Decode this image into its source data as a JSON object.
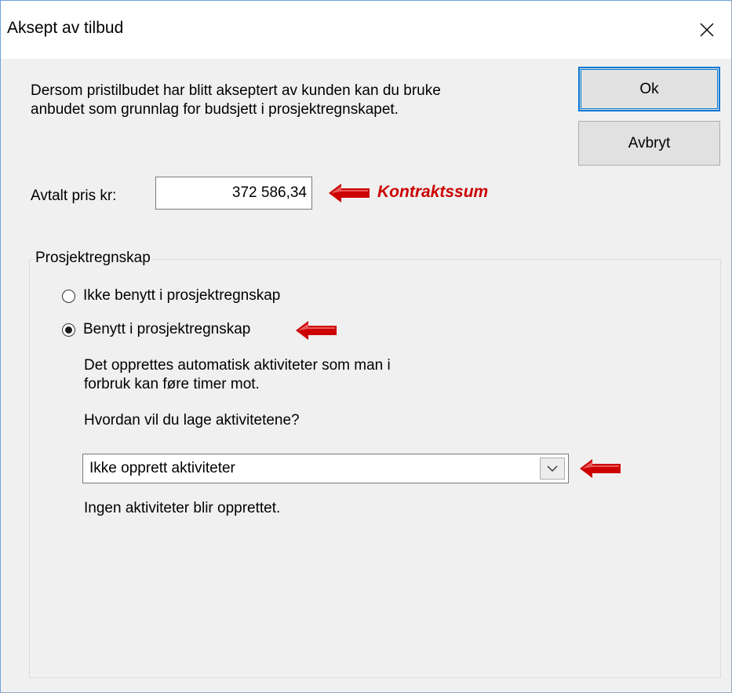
{
  "window": {
    "title": "Aksept av tilbud"
  },
  "intro_text": "Dersom pristilbudet har blitt akseptert av kunden kan du bruke\nanbudet som grunnlag for budsjett i prosjektregnskapet.",
  "buttons": {
    "ok_label": "Ok",
    "cancel_label": "Avbryt"
  },
  "price": {
    "label": "Avtalt pris kr:",
    "value": "372 586,34"
  },
  "annotations": {
    "callout_text": "Kontraktssum",
    "arrow_color": "#cc0000"
  },
  "project_accounting": {
    "group_label": "Prosjektregnskap",
    "options": [
      {
        "label": "Ikke benytt i prosjektregnskap",
        "selected": false
      },
      {
        "label": "Benytt i prosjektregnskap",
        "selected": true
      }
    ],
    "description": "Det opprettes automatisk aktiviteter som man i\nforbruk kan føre timer mot.",
    "question": "Hvordan vil du lage aktivitetene?",
    "dropdown_value": "Ikke opprett aktiviteter",
    "dropdown_note": "Ingen aktiviteter blir opprettet."
  },
  "icons": {
    "close": "close-icon",
    "dropdown": "chevron-down-icon",
    "pointer": "left-arrow-icon"
  },
  "colors": {
    "accent": "#0078d7",
    "callout": "#cc0000",
    "dialog_bg": "#f0f0f0"
  }
}
